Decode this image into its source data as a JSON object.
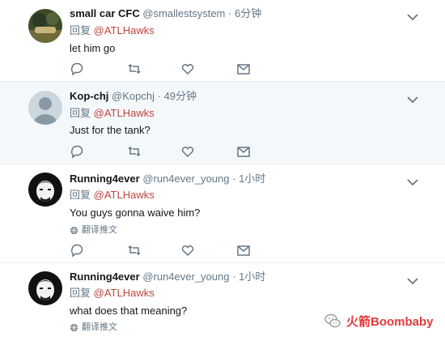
{
  "tweets": [
    {
      "name": "small car CFC",
      "handle": "@smallestsystem",
      "time": "6分钟",
      "reply_prefix": "回复",
      "mention": "@ATLHawks",
      "text": "let him go",
      "avatar": "photo"
    },
    {
      "name": "Kop-chj",
      "handle": "@Kopchj",
      "time": "49分钟",
      "reply_prefix": "回复",
      "mention": "@ATLHawks",
      "text": "Just for the tank?",
      "avatar": "default"
    },
    {
      "name": "Running4ever",
      "handle": "@run4ever_young",
      "time": "1小时",
      "reply_prefix": "回复",
      "mention": "@ATLHawks",
      "text": "You guys gonna waive him?",
      "translate": "翻译推文",
      "avatar": "illustration"
    },
    {
      "name": "Running4ever",
      "handle": "@run4ever_young",
      "time": "1小时",
      "reply_prefix": "回复",
      "mention": "@ATLHawks",
      "text": "what does that meaning?",
      "translate": "翻译推文",
      "avatar": "illustration"
    }
  ],
  "separator": "·",
  "watermark": "火箭Boombaby",
  "icons": {
    "reply": "reply-icon",
    "retweet": "retweet-icon",
    "like": "heart-icon",
    "dm": "envelope-icon",
    "caret": "chevron-down-icon",
    "globe": "globe-icon"
  },
  "colors": {
    "mention": "#c0453e",
    "muted": "#657786",
    "highlight_bg": "#f5f8fa"
  }
}
